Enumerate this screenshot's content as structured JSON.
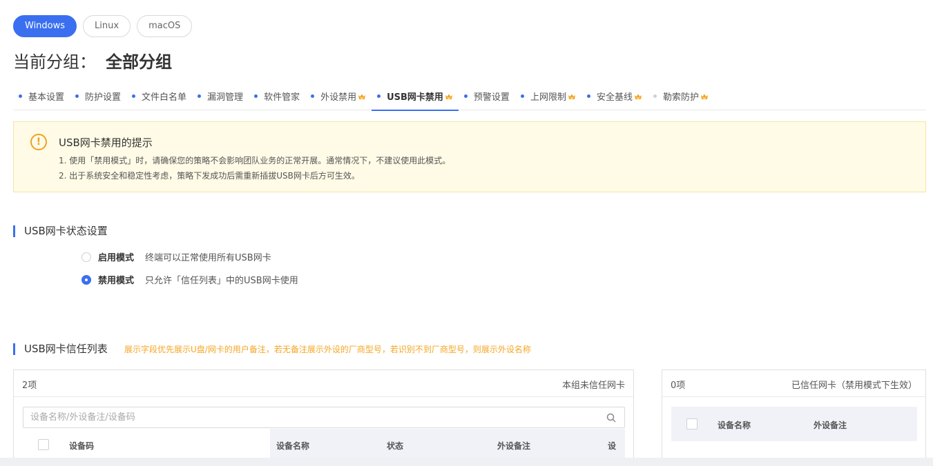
{
  "os_tabs": [
    "Windows",
    "Linux",
    "macOS"
  ],
  "group": {
    "label": "当前分组：",
    "name": "全部分组"
  },
  "nav": [
    {
      "label": "基本设置",
      "vip": false
    },
    {
      "label": "防护设置",
      "vip": false
    },
    {
      "label": "文件白名单",
      "vip": false
    },
    {
      "label": "漏洞管理",
      "vip": false
    },
    {
      "label": "软件管家",
      "vip": false
    },
    {
      "label": "外设禁用",
      "vip": true
    },
    {
      "label": "USB网卡禁用",
      "vip": true
    },
    {
      "label": "预警设置",
      "vip": false
    },
    {
      "label": "上网限制",
      "vip": true
    },
    {
      "label": "安全基线",
      "vip": true
    },
    {
      "label": "勒索防护",
      "vip": true
    }
  ],
  "notice": {
    "title": "USB网卡禁用的提示",
    "line1": "1. 使用「禁用模式」时，请确保您的策略不会影响团队业务的正常开展。通常情况下，不建议使用此模式。",
    "line2": "2. 出于系统安全和稳定性考虑，策略下发成功后需重新插拔USB网卡后方可生效。"
  },
  "status_section": {
    "title": "USB网卡状态设置",
    "options": [
      {
        "label": "启用模式",
        "desc": "终端可以正常使用所有USB网卡",
        "checked": false
      },
      {
        "label": "禁用模式",
        "desc": "只允许「信任列表」中的USB网卡使用",
        "checked": true
      }
    ]
  },
  "trust_section": {
    "title": "USB网卡信任列表",
    "hint": "展示字段优先展示U盘/网卡的用户备注，若无备注展示外设的厂商型号，若识别不到厂商型号，则展示外设名称"
  },
  "left_panel": {
    "count": "2项",
    "label": "本组未信任网卡",
    "search_placeholder": "设备名称/外设备注/设备码",
    "columns": [
      "设备码",
      "设备名称",
      "状态",
      "外设备注",
      "设"
    ]
  },
  "right_panel": {
    "count": "0项",
    "label": "已信任网卡（禁用模式下生效）",
    "columns": [
      "设备名称",
      "外设备注"
    ]
  },
  "colors": {
    "accent": "#3a6ff0",
    "warning": "#f0a020",
    "hint": "#f5a623",
    "vip": "#f5a623"
  },
  "icons": {
    "notice": "warning-circle-icon",
    "search": "search-icon",
    "vip": "vip-crown-icon"
  }
}
